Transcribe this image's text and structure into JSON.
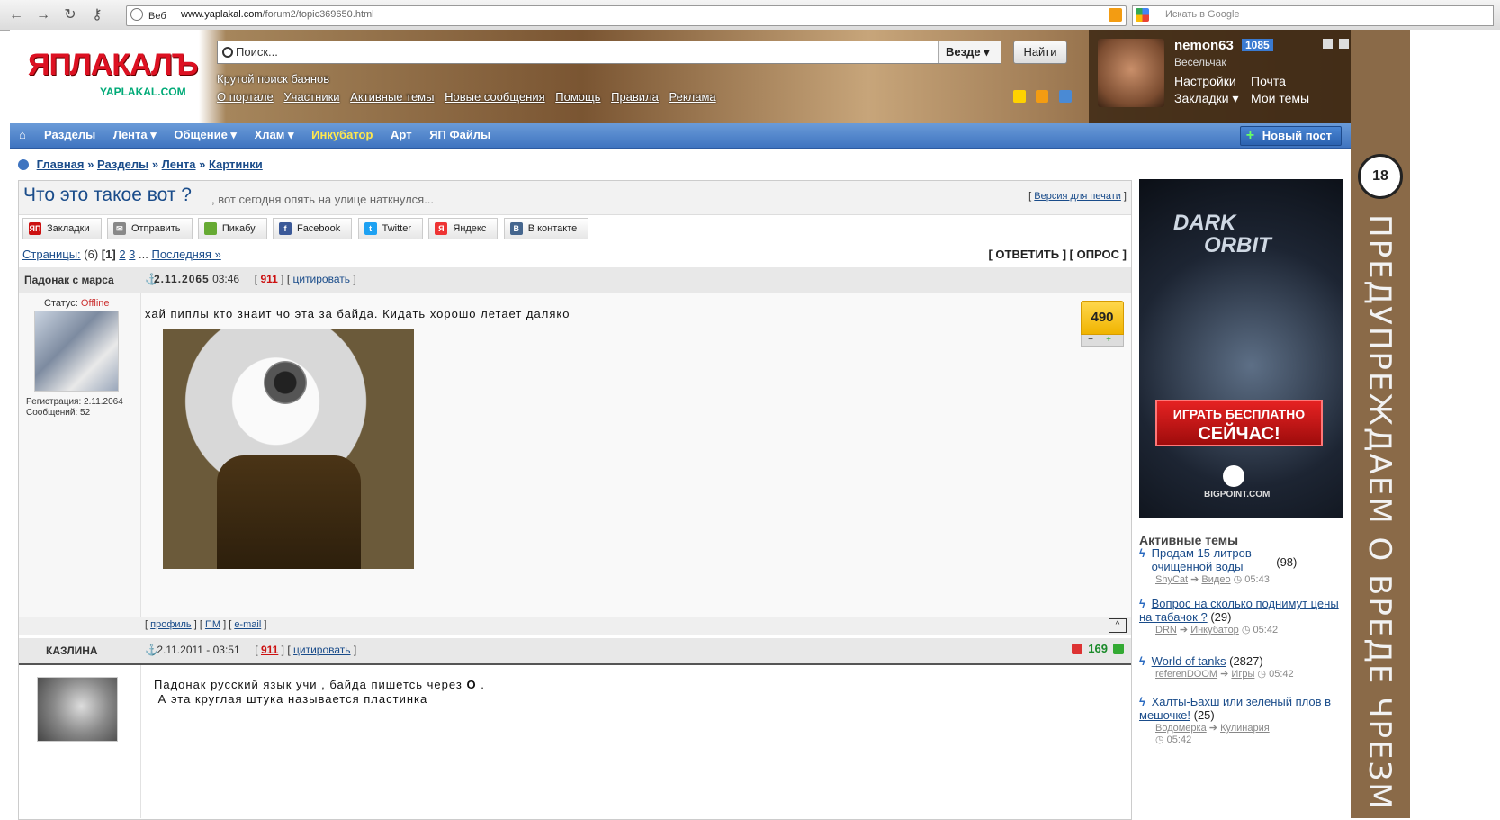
{
  "browser": {
    "url_prefix": "Веб",
    "url_host": "www.yaplakal.com",
    "url_path": "/forum2/topic369650.html",
    "search_placeholder": "Искать в Google"
  },
  "header": {
    "logo_main": "ЯПЛАКАЛЪ",
    "logo_sub": "YAPLAKAL.COM",
    "search_placeholder": "Поиск...",
    "search_scope": "Везде",
    "search_button": "Найти",
    "tagline": "Крутой поиск баянов",
    "links": [
      "О портале",
      "Участники",
      "Активные темы",
      "Новые сообщения",
      "Помощь",
      "Правила",
      "Реклама"
    ]
  },
  "user": {
    "name": "nemon63",
    "badge": "1085",
    "rank": "Весельчак",
    "settings": "Настройки",
    "bookmarks": "Закладки",
    "mail": "Почта",
    "my_topics": "Мои темы"
  },
  "nav": {
    "items": [
      "Разделы",
      "Лента ▾",
      "Общение ▾",
      "Хлам ▾",
      "Инкубатор",
      "Арт",
      "ЯП Файлы"
    ],
    "new_post": "Новый пост"
  },
  "breadcrumb": {
    "items": [
      "Главная",
      "Разделы",
      "Лента",
      "Картинки"
    ],
    "sep": "»"
  },
  "topic": {
    "title": "Что это такое вот ?",
    "desc": ", вот сегодня опять на улице наткнулся...",
    "print": "Версия для печати",
    "share": [
      "Закладки",
      "Отправить",
      "Пикабу",
      "Facebook",
      "Twitter",
      "Яндекс",
      "В контакте"
    ],
    "pages_label": "Страницы:",
    "pages_count": "(6)",
    "pages_current": "[1]",
    "pages_links": [
      "2",
      "3"
    ],
    "pages_last": "Последняя »",
    "reply": "[ ОТВЕТИТЬ ] [ ОПРОС ]"
  },
  "post1": {
    "author": "Падонак с марса",
    "date": "2.11.2065",
    "time": "03:46",
    "num": "911",
    "quote": "цитировать",
    "status_label": "Статус:",
    "status": "Offline",
    "reg_label": "Регистрация:",
    "reg_date": "2.11.2064",
    "msgs_label": "Сообщений:",
    "msgs": "52",
    "text": "хай пиплы кто знаит чо эта за байда. Кидать хорошо летает даляко",
    "rating": "490",
    "profile": "профиль",
    "pm": "ПМ",
    "email": "e-mail"
  },
  "post2": {
    "author": "КАЗЛИНА",
    "datetime": "2.11.2011 - 03:51",
    "num": "911",
    "quote": "цитировать",
    "rating": "169",
    "text1": "Падонак русский язык учи , байда  пишетсь через",
    "text1_bold": "О",
    "text1_end": ".",
    "text2": "А эта круглая штука называется пластинка"
  },
  "ad": {
    "logo1": "DARK",
    "logo2": "ORBIT",
    "cta1": "ИГРАТЬ БЕСПЛАТНО",
    "cta2": "СЕЙЧАС!",
    "brand": "BIGPOINT.COM"
  },
  "active": {
    "title": "Активные темы",
    "threads": [
      {
        "title": "Продам 15 литров очищенной воды",
        "count": "(98)",
        "user": "ShyCat",
        "section": "Видео",
        "time": "05:43"
      },
      {
        "title": "Вопрос на сколько поднимут цены на табачок ?",
        "count": "(29)",
        "user": "DRN",
        "section": "Инкубатор",
        "time": "05:42"
      },
      {
        "title": "World of tanks",
        "count": "(2827)",
        "user": "referenDOOM",
        "section": "Игры",
        "time": "05:42"
      },
      {
        "title": "Халты-Бахш или зеленый плов в мешочке!",
        "count": "(25)",
        "user": "Водомерка",
        "section": "Кулинария",
        "time": "05:42"
      }
    ]
  },
  "strip": {
    "badge": "18",
    "text": "ПРЕДУПРЕЖДАЕМ О ВРЕДЕ ЧРЕЗМ"
  },
  "colors": {
    "nav_blue": "#3f74c0",
    "link_blue": "#1a4c8a",
    "rating_yellow": "#ffd84d",
    "offline_red": "#cc3333"
  }
}
